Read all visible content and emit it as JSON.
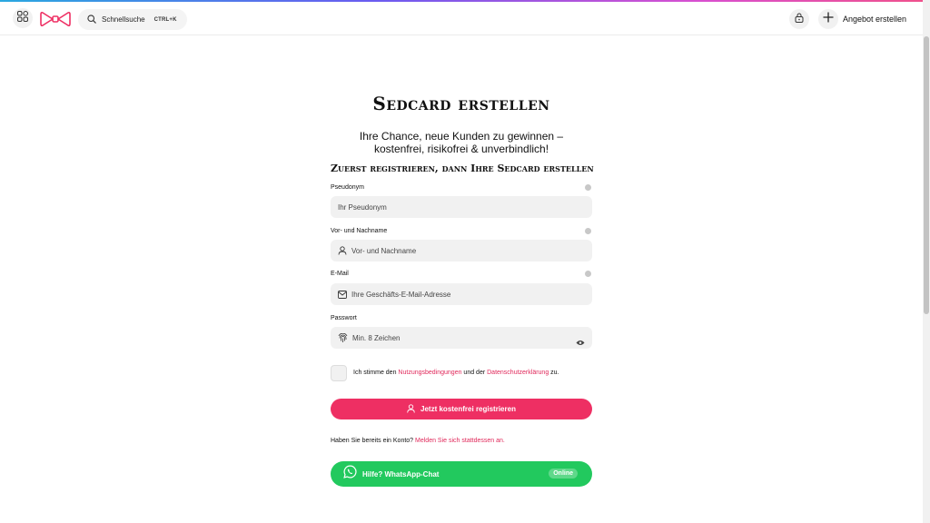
{
  "header": {
    "search_label": "Schnellsuche",
    "search_shortcut": "CTRL+K",
    "create_offer_label": "Angebot erstellen",
    "icons": [
      "apps-icon",
      "bow-logo-icon",
      "search-icon",
      "lock-icon",
      "plus-icon"
    ]
  },
  "page": {
    "title": "Sedcard erstellen",
    "subtitle_line1": "Ihre Chance, neue Kunden zu gewinnen –",
    "subtitle_line2": "kostenfrei, risikofrei & unverbindlich!",
    "section_title": "Zuerst registrieren, dann Ihre Sedcard erstellen"
  },
  "form": {
    "pseudonym_label": "Pseudonym",
    "pseudonym_placeholder": "Ihr Pseudonym",
    "name_label": "Vor- und Nachname",
    "name_placeholder": "Vor- und Nachname",
    "email_label": "E-Mail",
    "email_placeholder": "Ihre Geschäfts-E-Mail-Adresse",
    "password_label": "Passwort",
    "password_placeholder": "Min. 8 Zeichen",
    "terms_prefix": "Ich stimme den ",
    "terms_link": "Nutzungsbedingungen",
    "terms_middle": " und der ",
    "privacy_link": "Datenschutzerklärung",
    "terms_suffix": " zu.",
    "register_button": "Jetzt kostenfrei registrieren",
    "login_question": "Haben Sie bereits ein Konto? ",
    "login_link": "Melden Sie sich stattdessen an."
  },
  "whatsapp": {
    "label": "Hilfe? WhatsApp-Chat",
    "status": "Online"
  },
  "colors": {
    "accent_pink": "#ee2f63",
    "link_pink": "#e0285a",
    "whatsapp_green": "#22c95e"
  }
}
